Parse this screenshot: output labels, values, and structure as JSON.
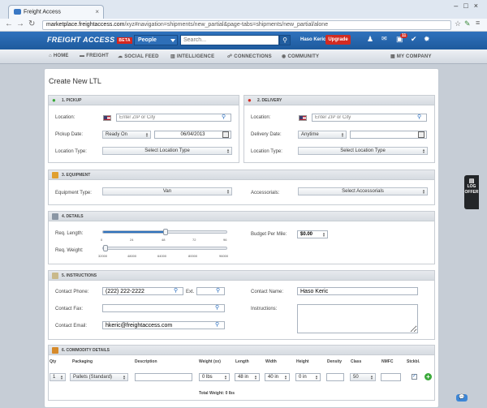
{
  "browser": {
    "tab_title": "Freight Access",
    "url_domain": "marketplace.freightaccess.com",
    "url_path": "/xyz#navigation=shipments/new_partial&page-tabs=shipments/new_partial/alone"
  },
  "appbar": {
    "logo": "FREIGHT ACCESS",
    "beta": "BETA",
    "people_label": "People",
    "search_placeholder": "Search...",
    "user_name": "Haso Keric",
    "upgrade": "Upgrade",
    "notification_count": "11"
  },
  "menu": [
    "HOME",
    "FREIGHT",
    "SOCIAL FEED",
    "INTELLIGENCE",
    "CONNECTIONS",
    "COMMUNITY"
  ],
  "my_company": "MY COMPANY",
  "side_tab": [
    "LOG",
    "OFFER"
  ],
  "page_title": "Create New LTL",
  "pickup": {
    "header": "1. PICKUP",
    "location_label": "Location:",
    "location_placeholder": "Enter ZIP or City",
    "date_label": "Pickup Date:",
    "date_mode": "Ready On",
    "date_value": "06/04/2013",
    "type_label": "Location Type:",
    "type_value": "Select Location Type"
  },
  "delivery": {
    "header": "2. DELIVERY",
    "location_label": "Location:",
    "location_placeholder": "Enter ZIP or City",
    "date_label": "Delivery Date:",
    "date_mode": "Anytime",
    "date_value": "",
    "type_label": "Location Type:",
    "type_value": "Select Location Type"
  },
  "equipment": {
    "header": "3. EQUIPMENT",
    "type_label": "Equipment Type:",
    "type_value": "Van",
    "accessorials_label": "Accessorials:",
    "accessorials_value": "Select Accessorials"
  },
  "details": {
    "header": "4. DETAILS",
    "length_label": "Req. Length:",
    "length_ticks": [
      "0",
      "24",
      "48",
      "72",
      "96"
    ],
    "length_value": 48,
    "length_max": 96,
    "weight_label": "Req. Weight:",
    "weight_ticks": [
      "32000",
      "48000",
      "64000",
      "80000",
      "96000"
    ],
    "weight_value": 32000,
    "weight_min": 32000,
    "weight_max": 96000,
    "budget_label": "Budget Per Mile:",
    "budget_value": "$0.00"
  },
  "instructions": {
    "header": "5. INSTRUCTIONS",
    "phone_label": "Contact Phone:",
    "phone_value": "(222) 222-2222",
    "ext_label": "Ext.",
    "fax_label": "Contact Fax:",
    "email_label": "Contact Email:",
    "email_value": "hkeric@freightaccess.com",
    "name_label": "Contact Name:",
    "name_value": "Haso Keric",
    "instructions_label": "Instructions:"
  },
  "commodity": {
    "header": "6. COMMODITY DETAILS",
    "columns": [
      "Qty",
      "Packaging",
      "Description",
      "Weight (xx)",
      "Length",
      "Width",
      "Height",
      "Density",
      "Class",
      "NMFC",
      "Stckbl."
    ],
    "row": {
      "qty": "1",
      "packaging": "Pallets (Standard)",
      "description": "",
      "weight": "0 lbs",
      "length": "48 in",
      "width": "40 in",
      "height": "0 in",
      "density": "",
      "class": "50",
      "nmfc": "",
      "stackable": true
    },
    "total_weight_label": "Total Weight: 0 lbs"
  },
  "colors": {
    "brand": "#2f72bd",
    "upgrade": "#d22b22",
    "add": "#3aa93a"
  }
}
